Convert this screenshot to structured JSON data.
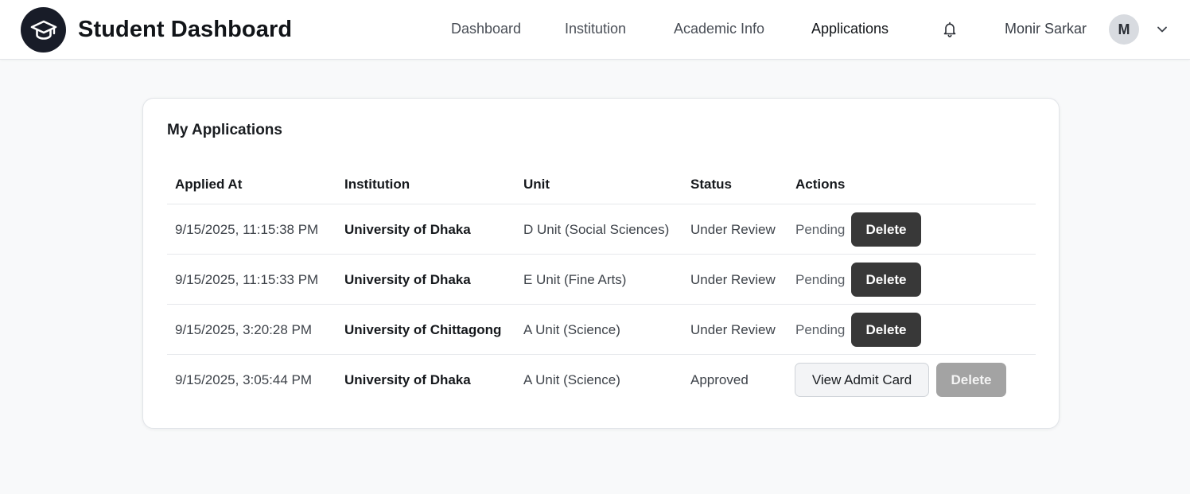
{
  "app": {
    "title": "Student Dashboard"
  },
  "nav": {
    "items": [
      {
        "label": "Dashboard",
        "active": false
      },
      {
        "label": "Institution",
        "active": false
      },
      {
        "label": "Academic Info",
        "active": false
      },
      {
        "label": "Applications",
        "active": true
      }
    ]
  },
  "user": {
    "name": "Monir Sarkar",
    "initial": "M"
  },
  "icons": {
    "logo": "graduation-cap-icon",
    "notifications": "bell-icon",
    "menu": "chevron-down-icon"
  },
  "applications": {
    "title": "My Applications",
    "columns": [
      "Applied At",
      "Institution",
      "Unit",
      "Status",
      "Actions"
    ],
    "rows": [
      {
        "applied_at": "9/15/2025, 11:15:38 PM",
        "institution": "University of Dhaka",
        "unit": "D Unit (Social Sciences)",
        "status": "Under Review",
        "action_text": "Pending",
        "delete_label": "Delete"
      },
      {
        "applied_at": "9/15/2025, 11:15:33 PM",
        "institution": "University of Dhaka",
        "unit": "E Unit (Fine Arts)",
        "status": "Under Review",
        "action_text": "Pending",
        "delete_label": "Delete"
      },
      {
        "applied_at": "9/15/2025, 3:20:28 PM",
        "institution": "University of Chittagong",
        "unit": "A Unit (Science)",
        "status": "Under Review",
        "action_text": "Pending",
        "delete_label": "Delete"
      },
      {
        "applied_at": "9/15/2025, 3:05:44 PM",
        "institution": "University of Dhaka",
        "unit": "A Unit (Science)",
        "status": "Approved",
        "admit_label": "View Admit Card",
        "delete_label": "Delete",
        "delete_disabled": true
      }
    ]
  },
  "colors": {
    "logo_bg": "#181c28",
    "delete_bg": "#383838",
    "delete_disabled_bg": "#a3a3a3",
    "page_bg": "#f8f9fa"
  }
}
